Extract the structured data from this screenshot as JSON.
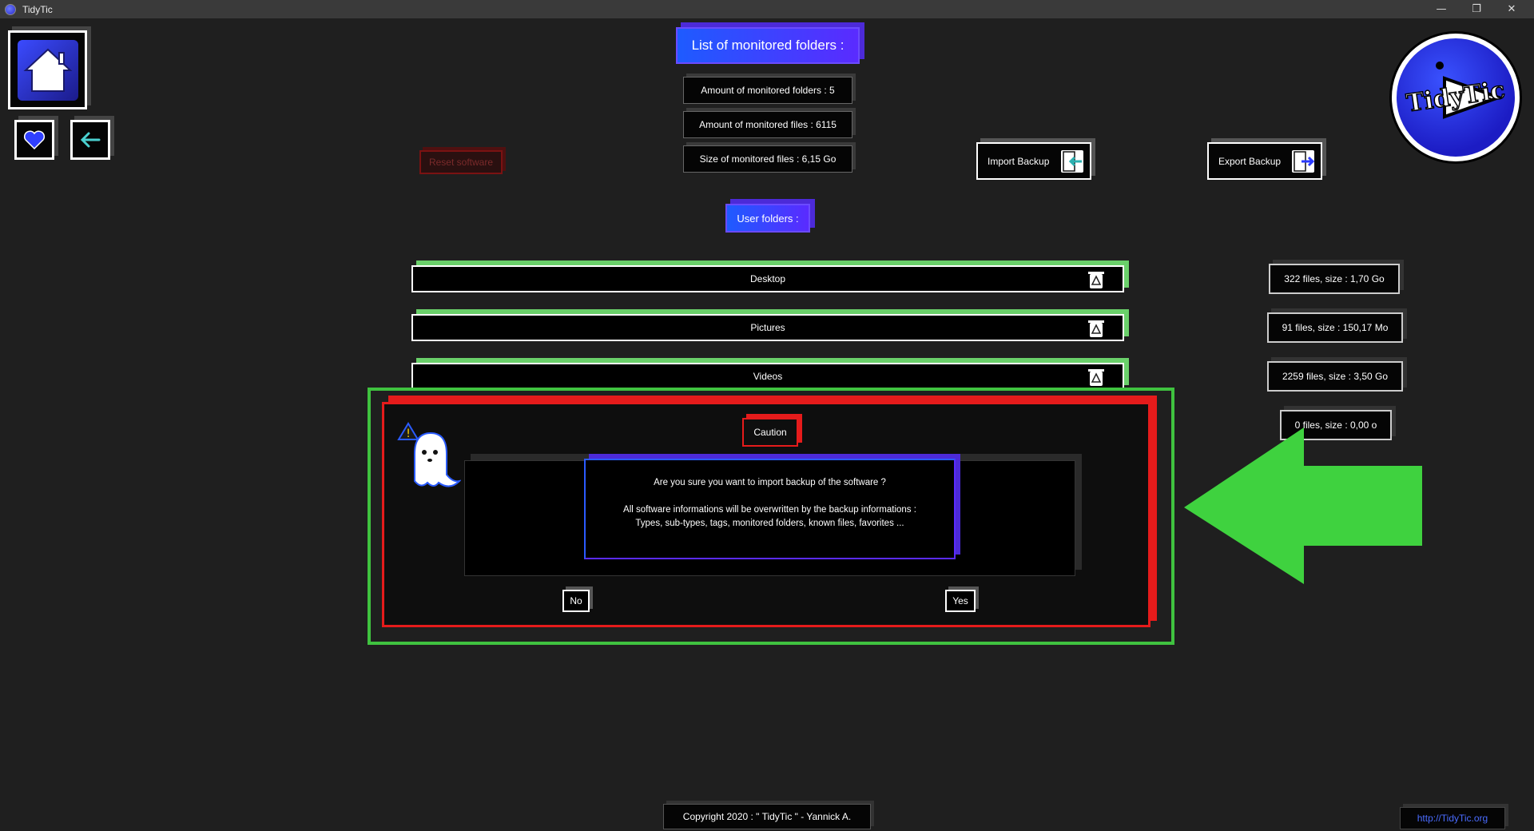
{
  "window": {
    "title": "TidyTic",
    "minimize": "—",
    "restore": "❐",
    "close": "✕"
  },
  "header": {
    "list_title": "List of monitored folders :",
    "stats": [
      "Amount of monitored folders : 5",
      "Amount of monitored files : 6115",
      "Size of monitored files : 6,15 Go"
    ]
  },
  "actions": {
    "reset": "Reset software",
    "import": "Import Backup",
    "export": "Export Backup"
  },
  "logo_text": "TidyTic",
  "user_folders_label": "User folders :",
  "folders": [
    {
      "name": "Desktop",
      "stats": "322 files, size : 1,70 Go"
    },
    {
      "name": "Pictures",
      "stats": "91 files, size : 150,17 Mo"
    },
    {
      "name": "Videos",
      "stats": "2259 files, size : 3,50 Go"
    },
    {
      "name": "",
      "stats": "0 files, size : 0,00 o"
    }
  ],
  "dialog": {
    "title": "Caution",
    "line1": "Are you sure you want to import backup of the software ?",
    "line2": "All software informations will be overwritten by the backup informations :",
    "line3": "Types, sub-types, tags, monitored folders, known files, favorites ...",
    "no": "No",
    "yes": "Yes"
  },
  "footer": {
    "copyright": "Copyright 2020 : \" TidyTic \" - Yannick A.",
    "website": "http://TidyTic.org"
  },
  "colors": {
    "accent_blue": "#1e5bff",
    "accent_purple": "#5a2bff",
    "folder_edge": "#6ad06a",
    "danger": "#e51b1b",
    "highlight": "#3fc23f"
  }
}
